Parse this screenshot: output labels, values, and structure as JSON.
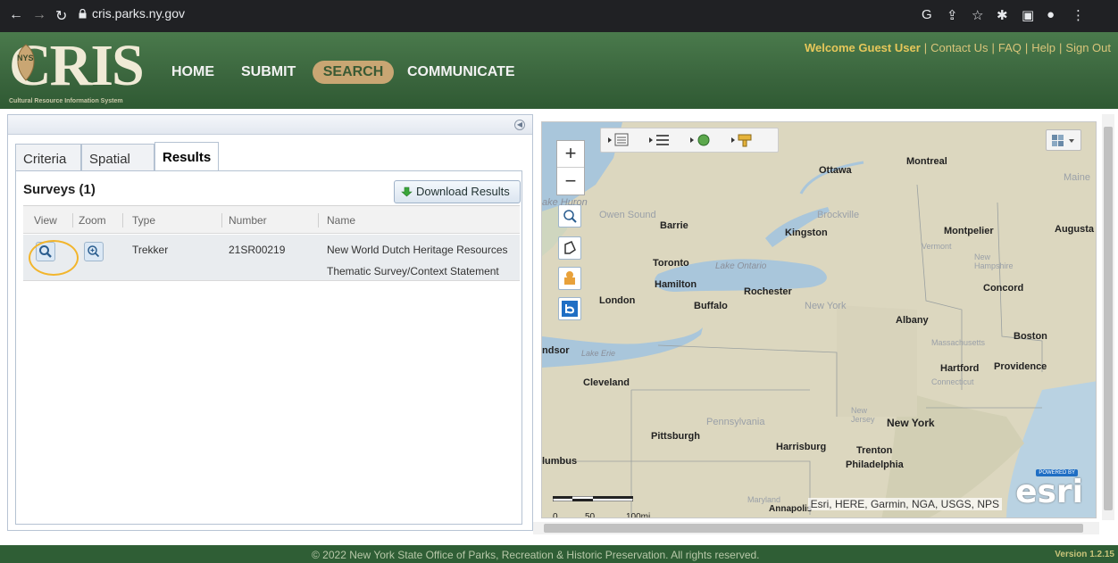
{
  "browser": {
    "url": "cris.parks.ny.gov"
  },
  "header": {
    "logo_text": "CRIS",
    "logo_badge": "NYS",
    "logo_subtitle": "Cultural Resource Information System",
    "nav": {
      "home": "HOME",
      "submit": "SUBMIT",
      "search": "SEARCH",
      "communicate": "COMMUNICATE"
    },
    "links": {
      "welcome": "Welcome Guest User",
      "contact": "Contact Us",
      "faq": "FAQ",
      "help": "Help",
      "signout": "Sign Out"
    }
  },
  "panel": {
    "tabs": [
      "Criteria",
      "Spatial",
      "Results"
    ],
    "active_tab": "Results",
    "surveys_title": "Surveys (1)",
    "download_label": "Download Results",
    "columns": [
      "View",
      "Zoom",
      "Type",
      "Number",
      "Name"
    ],
    "rows": [
      {
        "type": "Trekker",
        "number": "21SR00219",
        "name_line1": "New World Dutch Heritage Resources",
        "name_line2": "Thematic Survey/Context Statement"
      }
    ]
  },
  "map": {
    "labels": {
      "ottawa": "Ottawa",
      "montreal": "Montreal",
      "maine": "Maine",
      "huron": "ake Huron",
      "owen_sound": "Owen Sound",
      "barrie": "Barrie",
      "brockville": "Brockville",
      "kingston": "Kingston",
      "montpelier": "Montpelier",
      "augusta": "Augusta",
      "vermont": "Vermont",
      "new_hampshire": "New Hampshire",
      "toronto": "Toronto",
      "lake_ontario": "Lake Ontario",
      "hamilton": "Hamilton",
      "rochester": "Rochester",
      "concord": "Concord",
      "london": "London",
      "buffalo": "Buffalo",
      "new_york_state": "New York",
      "albany": "Albany",
      "massachusetts": "Massachusetts",
      "boston": "Boston",
      "windsor": "ndsor",
      "lake_erie": "Lake Erie",
      "hartford": "Hartford",
      "providence": "Providence",
      "connecticut": "Connecticut",
      "cleveland": "Cleveland",
      "new_jersey": "New Jersey",
      "new_york_city": "New York",
      "pennsylvania": "Pennsylvania",
      "pittsburgh": "Pittsburgh",
      "harrisburg": "Harrisburg",
      "trenton": "Trenton",
      "columbus": "lumbus",
      "philadelphia": "Philadelphia",
      "maryland": "Maryland",
      "annapolis": "Annapolis"
    },
    "scale": [
      "0",
      "50",
      "100mi"
    ],
    "attribution": "Esri, HERE, Garmin, NGA, USGS, NPS",
    "esri_powered": "POWERED BY",
    "esri_logo": "esri"
  },
  "footer": {
    "copyright": "© 2022 New York State Office of Parks, Recreation & Historic Preservation. All rights reserved.",
    "version": "Version 1.2.15"
  },
  "colors": {
    "header_green": "#3a653d",
    "search_pill": "#c9a673",
    "highlight_ring": "#f2b52c",
    "footer_green": "#2f5e35"
  }
}
